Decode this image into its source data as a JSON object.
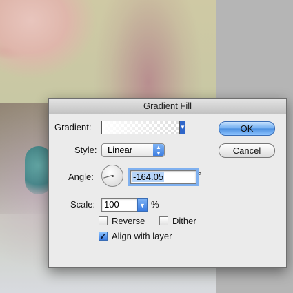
{
  "dialog": {
    "title": "Gradient Fill",
    "gradient_label": "Gradient:",
    "style_label": "Style:",
    "style_value": "Linear",
    "angle_label": "Angle:",
    "angle_value": "-164.05",
    "degree_symbol": "°",
    "scale_label": "Scale:",
    "scale_value": "100",
    "percent_symbol": "%",
    "ok_label": "OK",
    "cancel_label": "Cancel",
    "checkboxes": [
      {
        "label": "Reverse",
        "checked": false
      },
      {
        "label": "Dither",
        "checked": false
      },
      {
        "label": "Align with layer",
        "checked": true
      }
    ]
  },
  "icons": {
    "dropdown_arrow": "dropdown-arrow-icon",
    "stepper": "stepper-arrows-icon",
    "checkmark": "checkmark-icon"
  },
  "colors": {
    "accent": "#3a7be0",
    "dialog_bg": "#ebebeb",
    "selection": "#b6d4f8"
  }
}
